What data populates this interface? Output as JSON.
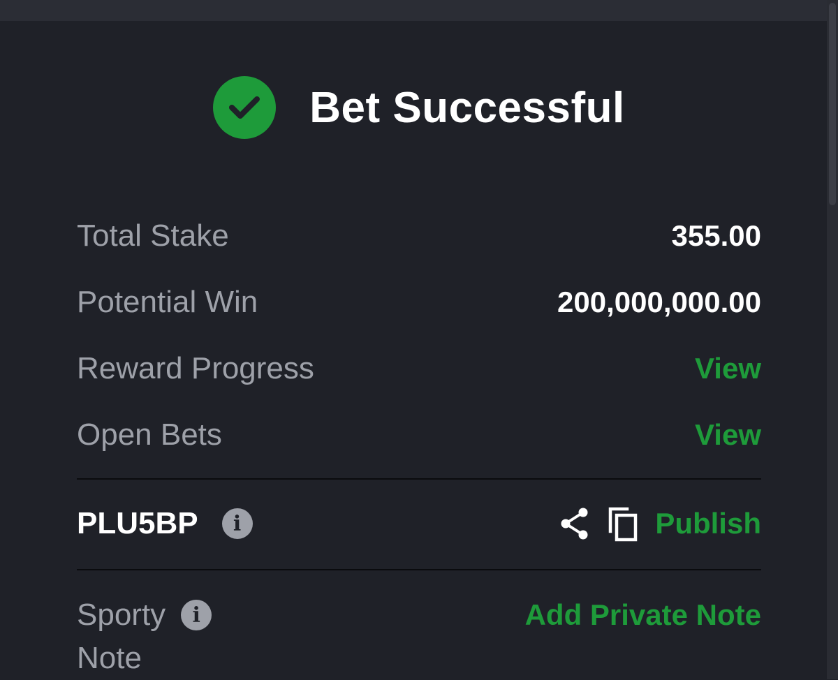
{
  "colors": {
    "accent_green": "#1e9b3a",
    "background": "#1f2128",
    "label_gray": "#9ea1a9",
    "text_white": "#ffffff"
  },
  "header": {
    "icon": "check-circle-icon",
    "title": "Bet Successful"
  },
  "summary": {
    "total_stake_label": "Total Stake",
    "total_stake_value": "355.00",
    "potential_win_label": "Potential Win",
    "potential_win_value": "200,000,000.00",
    "reward_progress_label": "Reward Progress",
    "reward_progress_link": "View",
    "open_bets_label": "Open Bets",
    "open_bets_link": "View"
  },
  "booking": {
    "code": "PLU5BP",
    "info_icon": "info-icon",
    "share_icon": "share-icon",
    "copy_icon": "copy-icon",
    "publish_label": "Publish"
  },
  "note": {
    "label_line1": "Sporty",
    "label_line2": "Note",
    "info_icon": "info-icon",
    "add_label": "Add Private Note"
  }
}
